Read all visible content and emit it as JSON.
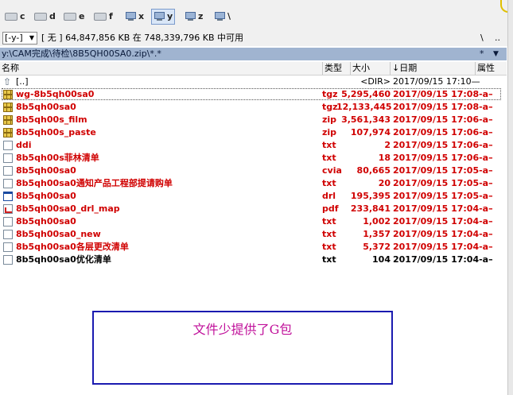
{
  "drives": [
    {
      "letter": "c",
      "icon": "drive-icon",
      "active": false
    },
    {
      "letter": "d",
      "icon": "drive-icon",
      "active": false
    },
    {
      "letter": "e",
      "icon": "drive-icon",
      "active": false
    },
    {
      "letter": "f",
      "icon": "drive-icon",
      "active": false
    },
    {
      "letter": "x",
      "icon": "network-drive-icon",
      "active": false
    },
    {
      "letter": "y",
      "icon": "network-drive-icon",
      "active": true
    },
    {
      "letter": "z",
      "icon": "network-drive-icon",
      "active": false
    },
    {
      "letter": "\\",
      "icon": "network-icon",
      "active": false
    }
  ],
  "info": {
    "drive_select": "[-y-]",
    "free_space": "[ 无 ]  64,847,856 KB 在 748,339,796 KB 中可用",
    "root_button": "\\",
    "up_button": ".."
  },
  "path": {
    "text": "y:\\CAM完成\\待检\\8B5QH00SA0.zip\\*.*",
    "filter": "*",
    "dropdown_icon": "triangle-down-icon"
  },
  "columns": {
    "name": "名称",
    "ext": "类型",
    "size": "大小",
    "date": "↓日期",
    "attr": "属性"
  },
  "files": [
    {
      "name": "[..]",
      "ext": "",
      "size": "<DIR>",
      "date": "2017/09/15 17:10—",
      "icon": "up-arrow-icon",
      "color": "black",
      "bold": false
    },
    {
      "name": "wg-8b5qh00sa0",
      "ext": "tgz",
      "size": "5,295,460",
      "date": "2017/09/15 17:08-a–",
      "icon": "archive-icon",
      "color": "red",
      "bold": true
    },
    {
      "name": "8b5qh00sa0",
      "ext": "tgz",
      "size": "12,133,445",
      "date": "2017/09/15 17:08-a–",
      "icon": "archive-icon",
      "color": "red",
      "bold": true
    },
    {
      "name": "8b5qh00s_film",
      "ext": "zip",
      "size": "3,561,343",
      "date": "2017/09/15 17:06-a–",
      "icon": "archive-icon",
      "color": "red",
      "bold": true
    },
    {
      "name": "8b5qh00s_paste",
      "ext": "zip",
      "size": "107,974",
      "date": "2017/09/15 17:06-a–",
      "icon": "archive-icon",
      "color": "red",
      "bold": true
    },
    {
      "name": "ddi",
      "ext": "txt",
      "size": "2",
      "date": "2017/09/15 17:06-a–",
      "icon": "document-icon",
      "color": "red",
      "bold": true
    },
    {
      "name": "8b5qh00s菲林清单",
      "ext": "txt",
      "size": "18",
      "date": "2017/09/15 17:06-a–",
      "icon": "document-icon",
      "color": "red",
      "bold": true
    },
    {
      "name": "8b5qh00sa0",
      "ext": "cvia",
      "size": "80,665",
      "date": "2017/09/15 17:05-a–",
      "icon": "document-icon",
      "color": "red",
      "bold": true
    },
    {
      "name": "8b5qh00sa0通知产品工程部提请购单",
      "ext": "txt",
      "size": "20",
      "date": "2017/09/15 17:05-a–",
      "icon": "document-icon",
      "color": "red",
      "bold": true
    },
    {
      "name": "8b5qh00sa0",
      "ext": "drl",
      "size": "195,395",
      "date": "2017/09/15 17:05-a–",
      "icon": "drill-file-icon",
      "color": "red",
      "bold": true
    },
    {
      "name": "8b5qh00sa0_drl_map",
      "ext": "pdf",
      "size": "233,841",
      "date": "2017/09/15 17:04-a–",
      "icon": "pdf-icon",
      "color": "red",
      "bold": true
    },
    {
      "name": "8b5qh00sa0",
      "ext": "txt",
      "size": "1,002",
      "date": "2017/09/15 17:04-a–",
      "icon": "document-icon",
      "color": "red",
      "bold": true
    },
    {
      "name": "8b5qh00sa0_new",
      "ext": "txt",
      "size": "1,357",
      "date": "2017/09/15 17:04-a–",
      "icon": "document-icon",
      "color": "red",
      "bold": true
    },
    {
      "name": "8b5qh00sa0各层更改清单",
      "ext": "txt",
      "size": "5,372",
      "date": "2017/09/15 17:04-a–",
      "icon": "document-icon",
      "color": "red",
      "bold": true
    },
    {
      "name": "8b5qh00sa0优化清单",
      "ext": "txt",
      "size": "104",
      "date": "2017/09/15 17:04-a–",
      "icon": "document-icon",
      "color": "black",
      "bold": true
    }
  ],
  "notice": {
    "text": "文件少提供了G包",
    "color": "#c0109a",
    "border_color": "#1a1ab0"
  },
  "colors": {
    "path_bar": "#a0b4d0",
    "red_file": "#d00000"
  }
}
